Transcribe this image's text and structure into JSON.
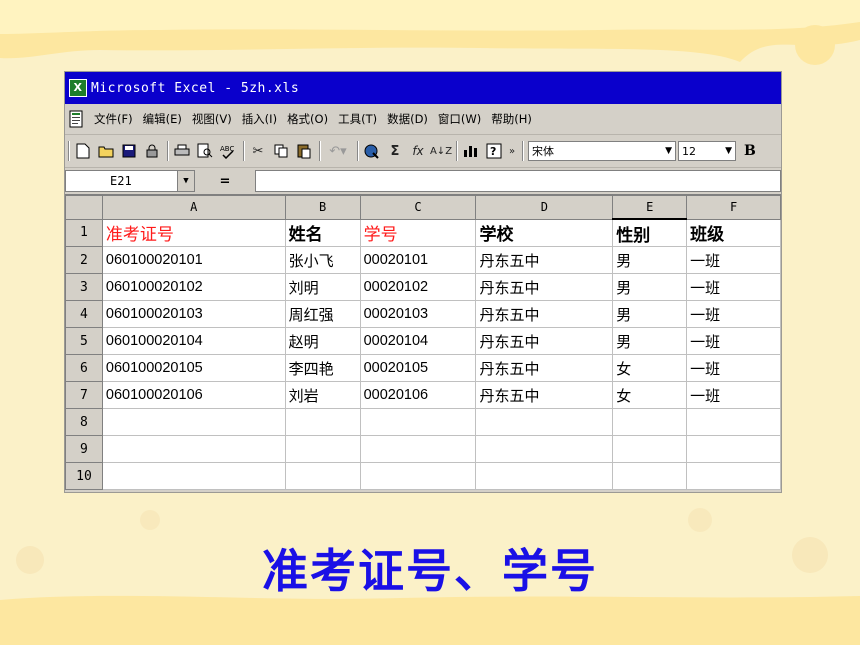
{
  "colors": {
    "slide_bg": "#fbf1c8",
    "titlebar": "#0a00cc",
    "caption": "#1a10e6",
    "highlight_red": "#ff1a1a"
  },
  "window": {
    "title": "Microsoft Excel - 5zh.xls",
    "app_icon": "X"
  },
  "menu": [
    "文件(F)",
    "编辑(E)",
    "视图(V)",
    "插入(I)",
    "格式(O)",
    "工具(T)",
    "数据(D)",
    "窗口(W)",
    "帮助(H)"
  ],
  "toolbar": {
    "icons": [
      "new-icon",
      "open-icon",
      "save-icon",
      "permission-icon",
      "print-icon",
      "print-preview-icon",
      "spelling-icon",
      "cut-icon",
      "copy-icon",
      "paste-icon",
      "undo-icon",
      "hyperlink-icon",
      "autosum-icon",
      "function-icon",
      "sort-icon",
      "chart-icon",
      "help-icon",
      "more-icon"
    ],
    "font": "宋体",
    "size": "12",
    "bold": "B"
  },
  "formula_bar": {
    "cell_ref": "E21",
    "equals": "="
  },
  "sheet": {
    "columns": [
      "A",
      "B",
      "C",
      "D",
      "E",
      "F"
    ],
    "row_numbers": [
      "1",
      "2",
      "3",
      "4",
      "5",
      "6",
      "7",
      "8",
      "9",
      "10"
    ],
    "headers": [
      "准考证号",
      "姓名",
      "学号",
      "学校",
      "性别",
      "班级"
    ],
    "rows": [
      [
        "060100020101",
        "张小飞",
        "00020101",
        "丹东五中",
        "男",
        "一班"
      ],
      [
        "060100020102",
        "刘明",
        "00020102",
        "丹东五中",
        "男",
        "一班"
      ],
      [
        "060100020103",
        "周红强",
        "00020103",
        "丹东五中",
        "男",
        "一班"
      ],
      [
        "060100020104",
        "赵明",
        "00020104",
        "丹东五中",
        "男",
        "一班"
      ],
      [
        "060100020105",
        "李四艳",
        "00020105",
        "丹东五中",
        "女",
        "一班"
      ],
      [
        "060100020106",
        "刘岩",
        "00020106",
        "丹东五中",
        "女",
        "一班"
      ]
    ]
  },
  "caption": "准考证号、学号"
}
